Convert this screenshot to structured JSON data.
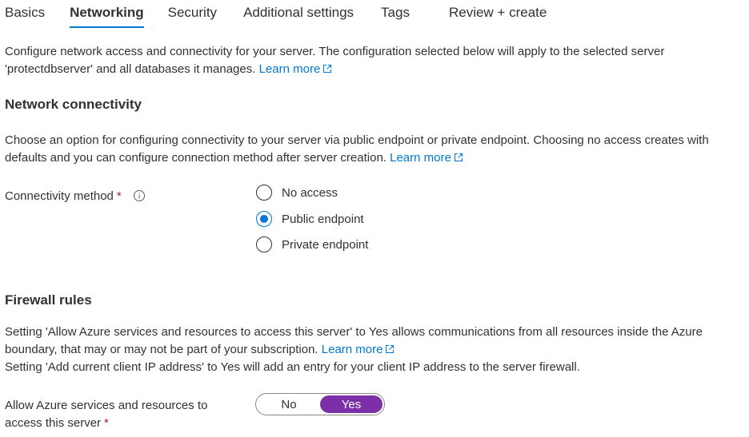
{
  "tabs": [
    {
      "label": "Basics",
      "active": false
    },
    {
      "label": "Networking",
      "active": true
    },
    {
      "label": "Security",
      "active": false
    },
    {
      "label": "Additional settings",
      "active": false
    },
    {
      "label": "Tags",
      "active": false
    },
    {
      "label": "Review + create",
      "active": false
    }
  ],
  "intro": {
    "text": "Configure network access and connectivity for your server. The configuration selected below will apply to the selected server 'protectdbserver' and all databases it manages.",
    "link": "Learn more"
  },
  "network_connectivity": {
    "heading": "Network connectivity",
    "description": "Choose an option for configuring connectivity to your server via public endpoint or private endpoint. Choosing no access creates with defaults and you can configure connection method after server creation.",
    "link": "Learn more",
    "connectivity_method": {
      "label": "Connectivity method",
      "required_mark": "*",
      "selected": "Public endpoint",
      "options": [
        "No access",
        "Public endpoint",
        "Private endpoint"
      ]
    }
  },
  "firewall_rules": {
    "heading": "Firewall rules",
    "description_1": "Setting 'Allow Azure services and resources to access this server' to Yes allows communications from all resources inside the Azure boundary, that may or may not be part of your subscription.",
    "link": "Learn more",
    "description_2": "Setting 'Add current client IP address' to Yes will add an entry for your client IP address to the server firewall.",
    "allow_azure": {
      "label": "Allow Azure services and resources to access this server",
      "required_mark": "*",
      "options": [
        "No",
        "Yes"
      ],
      "selected": "Yes"
    }
  },
  "colors": {
    "accent": "#0078d4",
    "toggle_selected": "#7d2fa7",
    "required": "#a4262c",
    "text": "#323130"
  },
  "icons": {
    "external_link": "external-link-icon",
    "info": "info-icon"
  }
}
